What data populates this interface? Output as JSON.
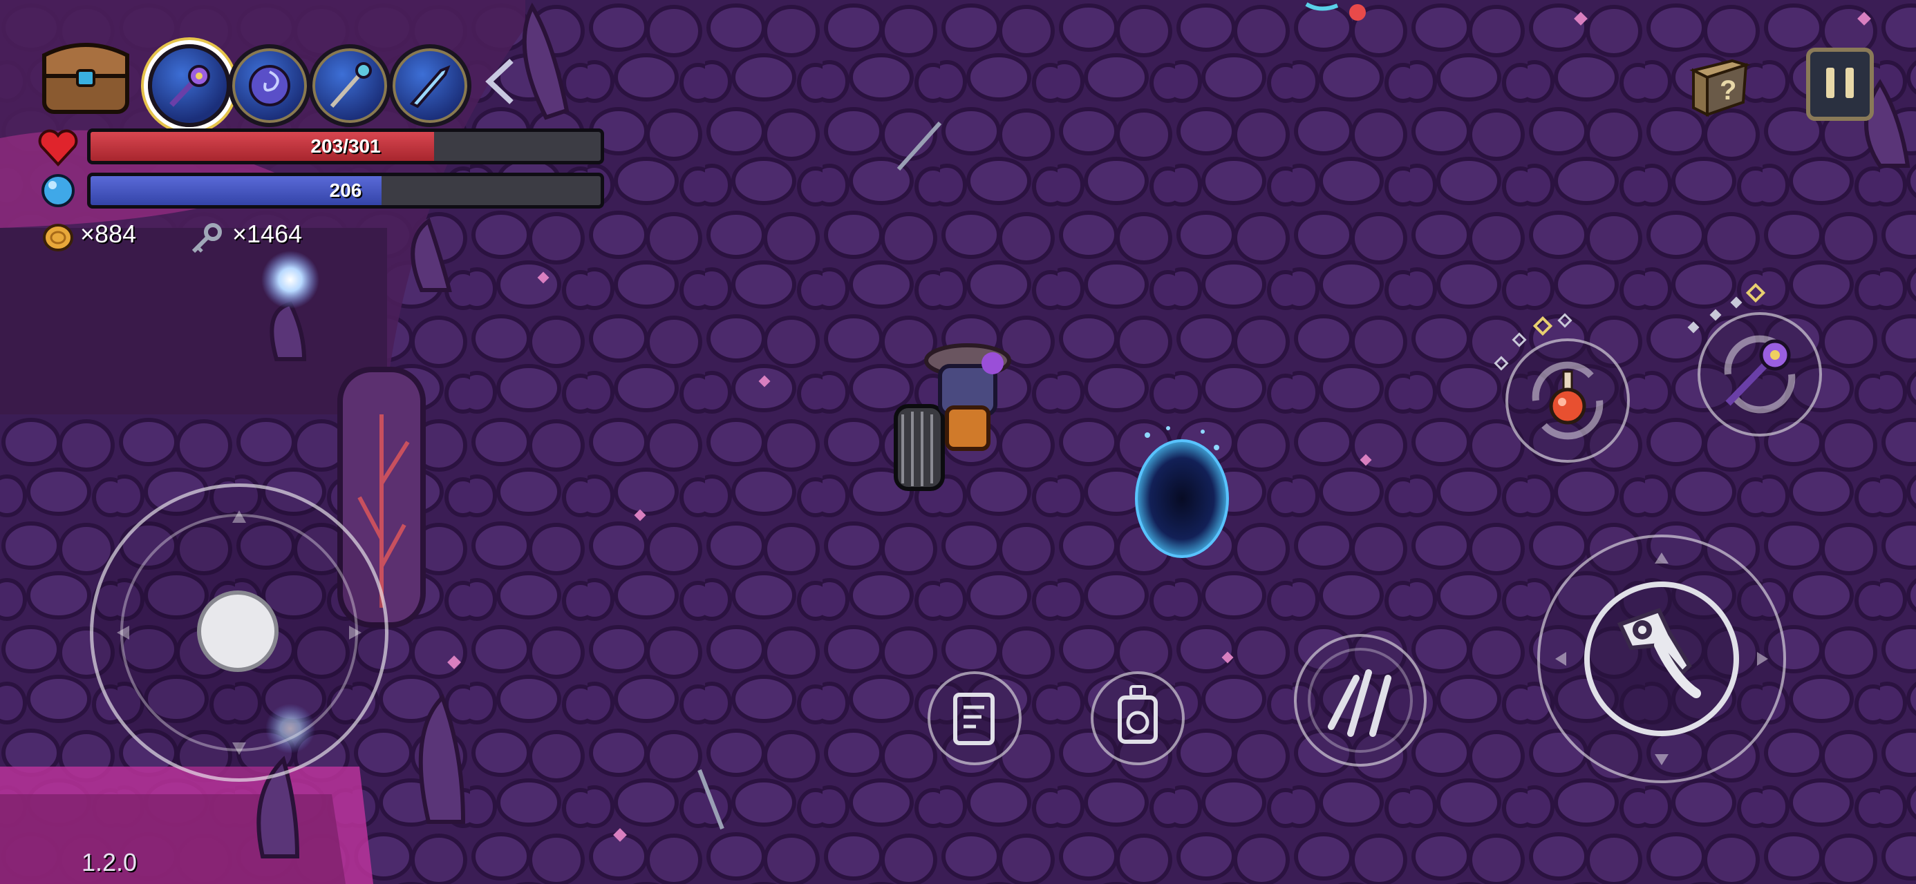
{
  "hud": {
    "health_text": "203/301",
    "health_fraction": 0.674,
    "mana_text": "206",
    "mana_fraction": 0.57,
    "coins_text": "×884",
    "keys_text": "×1464",
    "version": "1.2.0"
  },
  "weapon_slots": [
    {
      "icon": "spiked-mace-icon",
      "selected": true
    },
    {
      "icon": "vortex-orb-icon",
      "selected": false
    },
    {
      "icon": "magic-staff-icon",
      "selected": false
    },
    {
      "icon": "crystal-dagger-icon",
      "selected": false
    }
  ],
  "colors": {
    "health": "#c9343f",
    "mana": "#3f4fbf",
    "background": "#3a1d52",
    "accent_pink": "#d93fb0"
  }
}
